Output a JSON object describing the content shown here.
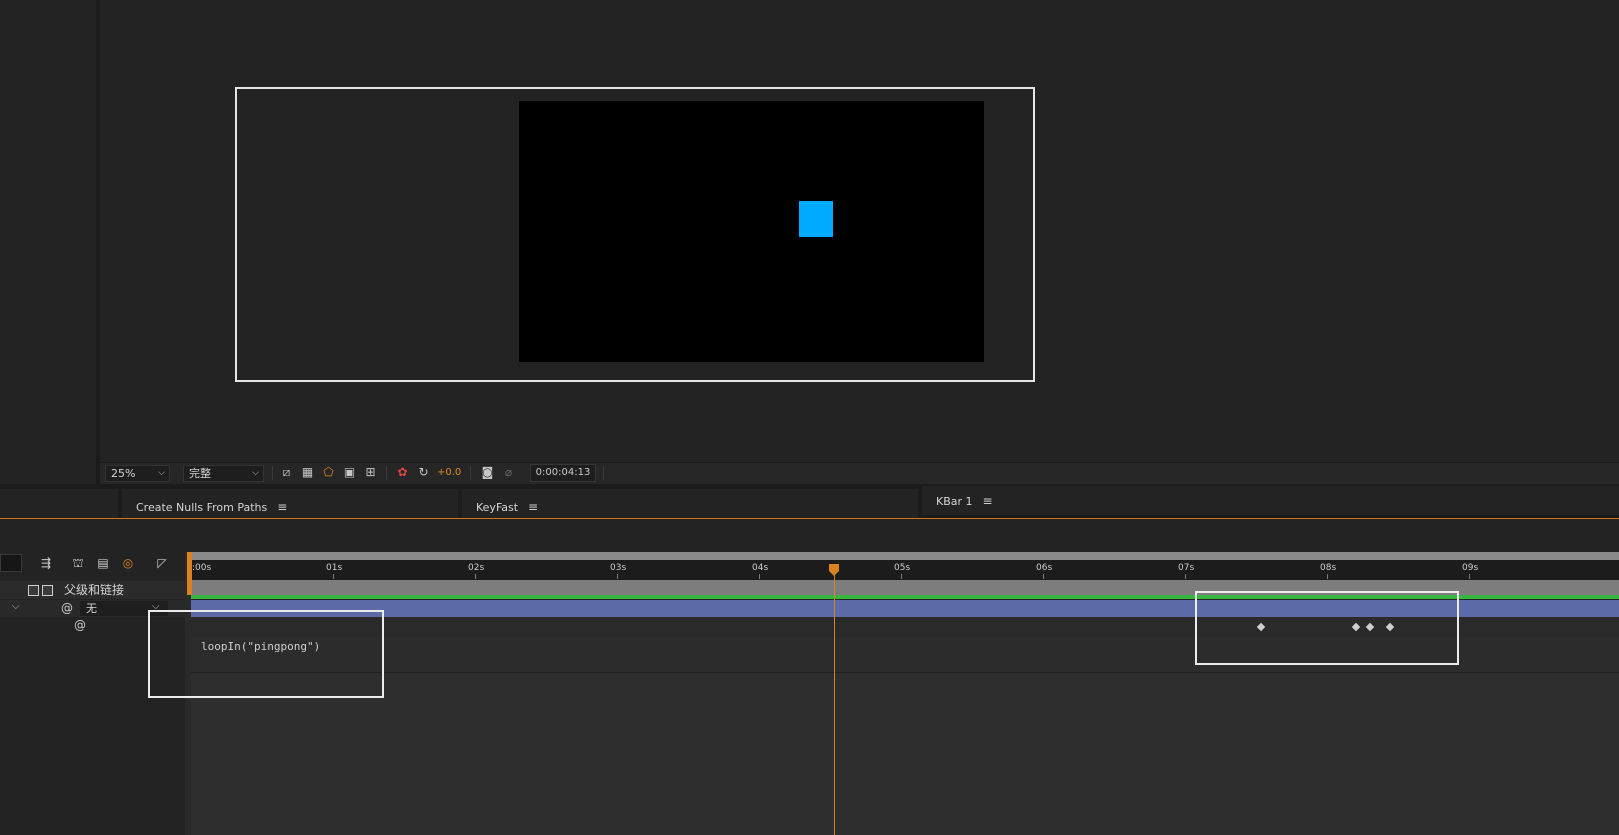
{
  "viewer": {
    "zoom": "25%",
    "resolution": "完整",
    "exposure": "+0.0",
    "timecode": "0:00:04:13",
    "shape_color": "#00aaff"
  },
  "panels": {
    "tab1": "Create Nulls From Paths",
    "tab2": "KeyFast",
    "tab3": "KBar 1",
    "menu_glyph": "≡"
  },
  "timeline": {
    "parent_column_label": "父级和链接",
    "parent_value": "无",
    "expression": "loopIn(\"pingpong\")",
    "ruler_labels": [
      "00s",
      "01s",
      "02s",
      "03s",
      "04s",
      "05s",
      "06s",
      "07s",
      "08s",
      "09s"
    ],
    "current_time": "0:00:04:13"
  },
  "colors": {
    "accent": "#d9821e",
    "layer_bar": "#5c6aa8",
    "green_bar": "#38b540"
  }
}
